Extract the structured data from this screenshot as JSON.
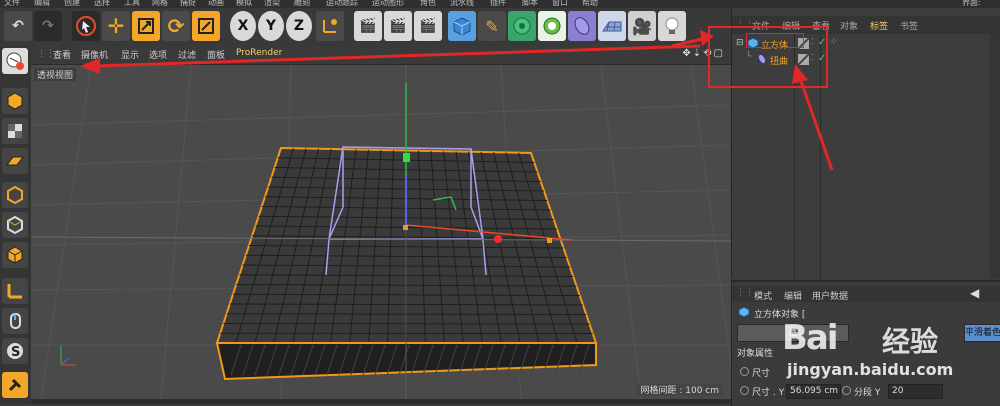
{
  "menubar": {
    "items": [
      "文件",
      "编辑",
      "创建",
      "选择",
      "工具",
      "网格",
      "捕捉",
      "动画",
      "模拟",
      "渲染",
      "雕刻",
      "运动跟踪",
      "运动图形",
      "角色",
      "流水线",
      "插件",
      "脚本",
      "窗口",
      "帮助"
    ],
    "right_label": "界面:"
  },
  "toolbar": {
    "axis_labels": [
      "X",
      "Y",
      "Z"
    ]
  },
  "viewport_menu": {
    "items": [
      "查看",
      "摄像机",
      "显示",
      "选项",
      "过滤",
      "面板",
      "ProRender"
    ]
  },
  "viewport": {
    "label": "透视视图",
    "grid_spacing": "网格间距 : 100 cm"
  },
  "object_manager": {
    "tabs": [
      "文件",
      "编辑",
      "查看",
      "对象",
      "标签",
      "书签"
    ],
    "objects": [
      {
        "name": "立方体",
        "color": "#f4a628",
        "icon": "cube-icon"
      },
      {
        "name": "扭曲",
        "color": "#f4a628",
        "icon": "bend-deformer-icon"
      }
    ]
  },
  "attribute_manager": {
    "tabs": [
      "模式",
      "编辑",
      "用户数据"
    ],
    "object_title": "立方体对象 [",
    "basic_button": "基",
    "phong_button": "平滑着色",
    "section_title": "对象属性",
    "size_rows": [
      {
        "label": "尺寸",
        "value": "",
        "segment_label": "分段",
        "segment_value": ""
      },
      {
        "label": "尺寸 . Y",
        "value": "56.095 cm",
        "segment_label": "分段 Y",
        "segment_value": "20"
      }
    ]
  },
  "watermark": {
    "text": "经验",
    "subtext": "jingyan.baidu.com"
  },
  "colors": {
    "accent": "#f4a628",
    "annotation_red": "#e02828",
    "viewport_bg": "#4a4a4a",
    "selection_orange": "#f09a1a"
  }
}
